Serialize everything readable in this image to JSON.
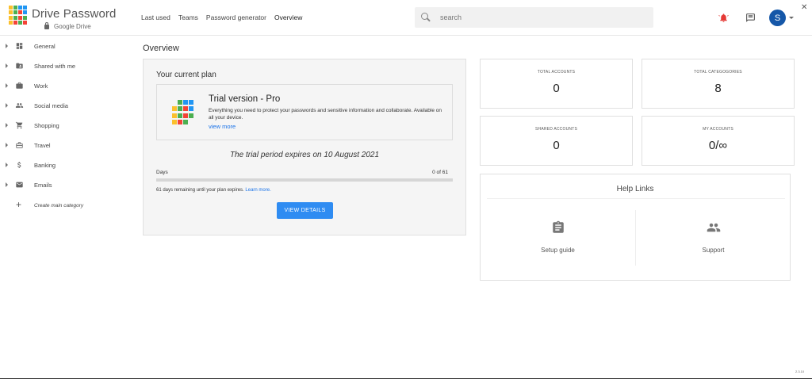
{
  "app": {
    "brand": "Drive Password",
    "brand_sub": "Google Drive",
    "version": "2.3.10"
  },
  "nav": {
    "items": [
      "Last used",
      "Teams",
      "Password generator",
      "Overview"
    ],
    "active": "Overview"
  },
  "search": {
    "placeholder": "search"
  },
  "header": {
    "avatar_letter": "S",
    "close": "✕"
  },
  "sidebar": {
    "items": [
      {
        "label": "General",
        "icon": "dashboard-icon"
      },
      {
        "label": "Shared with me",
        "icon": "shared-folder-icon"
      },
      {
        "label": "Work",
        "icon": "briefcase-icon"
      },
      {
        "label": "Social media",
        "icon": "people-icon"
      },
      {
        "label": "Shopping",
        "icon": "cart-icon"
      },
      {
        "label": "Travel",
        "icon": "luggage-icon"
      },
      {
        "label": "Banking",
        "icon": "dollar-icon"
      },
      {
        "label": "Emails",
        "icon": "mail-icon"
      }
    ],
    "create_label": "Create main category"
  },
  "main": {
    "title": "Overview",
    "plan": {
      "title": "Your current plan",
      "trial_head": "Trial version - Pro",
      "trial_desc": "Everything you need to protect your passwords and sensitive information and collaborate. Available on all your device.",
      "trial_link": "view more",
      "expire_text": "The trial period expires on 10 August 2021",
      "days_label": "Days",
      "days_count": "0 of 61",
      "days_used_fraction": 0,
      "remaining_text": "61 days remaining until your plan expires.",
      "learn_more": "Learn more.",
      "view_details": "VIEW DETAILS"
    },
    "stats": [
      {
        "label": "TOTAL ACCOUNTS",
        "value": "0"
      },
      {
        "label": "TOTAL CATEGOGORIES",
        "value": "8"
      },
      {
        "label": "SHARED ACCOUNTS",
        "value": "0"
      },
      {
        "label": "MY ACCOUNTS",
        "value": "0/∞"
      }
    ],
    "help": {
      "title": "Help Links",
      "setup_guide": "Setup guide",
      "support": "Support"
    }
  },
  "colors": {
    "accent": "#1a73e8",
    "button": "#2f8cf2",
    "avatar": "#1557a8",
    "bell": "#e53935",
    "logo": [
      "#4caf50",
      "#2196f3",
      "#f44336",
      "#ffc107"
    ]
  }
}
